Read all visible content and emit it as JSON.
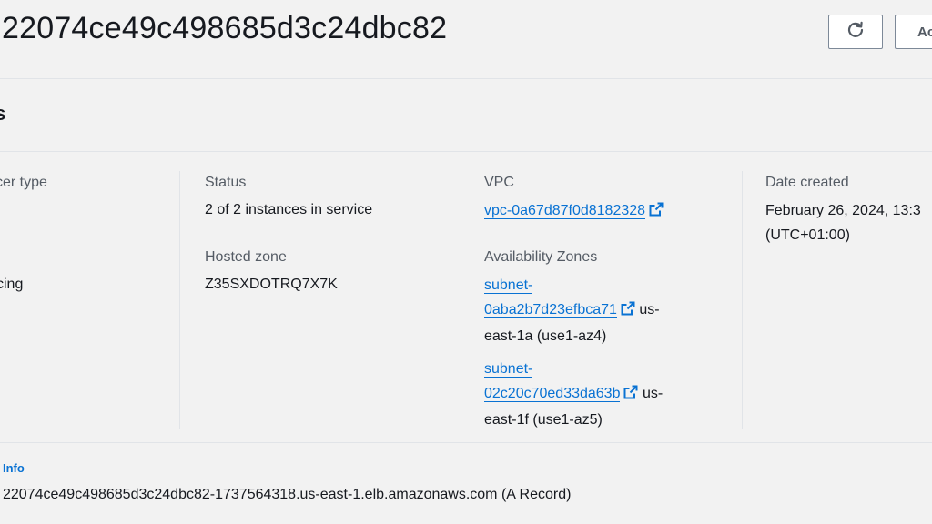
{
  "header": {
    "title": "22074ce49c498685d3c24dbc82",
    "refresh_icon": "refresh-icon",
    "actions_label": "Ac"
  },
  "details": {
    "section_title": "ls",
    "load_balancer_type": {
      "label": "cer type",
      "value": "cing"
    },
    "status": {
      "label": "Status",
      "value": "2 of 2 instances in service"
    },
    "hosted_zone": {
      "label": "Hosted zone",
      "value": "Z35SXDOTRQ7X7K"
    },
    "vpc": {
      "label": "VPC",
      "value": "vpc-0a67d87f0d8182328",
      "icon": "external-link-icon"
    },
    "availability_zones": {
      "label": "Availability Zones",
      "zones": [
        {
          "subnet_line1": "subnet-",
          "subnet_line2": "0aba2b7d23efbca71",
          "zone_suffix": "us-",
          "zone_line2": "east-1a (use1-az4)"
        },
        {
          "subnet_line1": "subnet-",
          "subnet_line2": "02c20c70ed33da63b",
          "zone_suffix": "us-",
          "zone_line2": "east-1f (use1-az5)"
        }
      ]
    },
    "date_created": {
      "label": "Date created",
      "value_line1": "February 26, 2024, 13:3",
      "value_line2": "(UTC+01:00)"
    }
  },
  "dns": {
    "info_label": "Info",
    "value": "22074ce49c498685d3c24dbc82-1737564318.us-east-1.elb.amazonaws.com (A Record)"
  },
  "colors": {
    "link": "#0972d3",
    "text": "#16191f",
    "label": "#545b64",
    "background": "#f2f2f2",
    "divider": "#e1e4e8"
  }
}
